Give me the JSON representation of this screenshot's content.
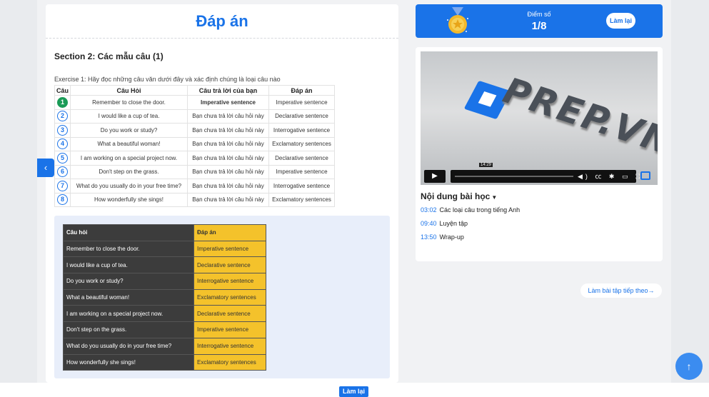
{
  "left_panel": {
    "title": "Đáp án",
    "section_title": "Section 2: Các mẫu câu (1)",
    "exercise_text": "Exercise 1: Hãy đọc những câu văn dưới đây và xác định chúng là loại câu nào",
    "table_headers": [
      "Câu",
      "Câu Hỏi",
      "Câu trả lời của bạn",
      "Đáp án"
    ],
    "rows": [
      {
        "num": "1",
        "question": "Remember to close the door.",
        "your_answer": "Imperative sentence",
        "answer": "Imperative sentence"
      },
      {
        "num": "2",
        "question": "I would like a cup of tea.",
        "your_answer": "Bạn chưa trả lời câu hỏi này",
        "answer": "Declarative sentence"
      },
      {
        "num": "3",
        "question": "Do you work or study?",
        "your_answer": "Bạn chưa trả lời câu hỏi này",
        "answer": "Interrogative sentence"
      },
      {
        "num": "4",
        "question": "What a beautiful woman!",
        "your_answer": "Bạn chưa trả lời câu hỏi này",
        "answer": "Exclamatory sentences"
      },
      {
        "num": "5",
        "question": "I am working on a special project now.",
        "your_answer": "Bạn chưa trả lời câu hỏi này",
        "answer": "Declarative sentence"
      },
      {
        "num": "6",
        "question": "Don't step on the grass.",
        "your_answer": "Bạn chưa trả lời câu hỏi này",
        "answer": "Imperative sentence"
      },
      {
        "num": "7",
        "question": "What do you usually do in your free time?",
        "your_answer": "Bạn chưa trả lời câu hỏi này",
        "answer": "Interrogative sentence"
      },
      {
        "num": "8",
        "question": "How wonderfully she sings!",
        "your_answer": "Bạn chưa trả lời câu hỏi này",
        "answer": "Exclamatory sentences"
      }
    ],
    "answer_table": {
      "headers": [
        "Câu hỏi",
        "Đáp án"
      ],
      "rows": [
        [
          "Remember to close the door.",
          "Imperative sentence"
        ],
        [
          "I would like a cup of tea.",
          "Declarative sentence"
        ],
        [
          "Do you work or study?",
          "Interrogative sentence"
        ],
        [
          "What a beautiful woman!",
          "Exclamatory sentences"
        ],
        [
          "I am working on a special project now.",
          "Declarative sentence"
        ],
        [
          "Don't step on the grass.",
          "Imperative sentence"
        ],
        [
          "What do you usually do in your free time?",
          "Interrogative sentence"
        ],
        [
          "How wonderfully she sings!",
          "Exclamatory sentences"
        ]
      ]
    },
    "side_tab_icon": "chevron-left-icon"
  },
  "score": {
    "label": "Điểm số",
    "value": "1/8",
    "retry_label": "Làm lại",
    "medal_icon": "medal-icon"
  },
  "video": {
    "logo_text": "PREP.VN",
    "time_tooltip": "14:29",
    "play_icon": "play-icon",
    "control_icons": "◀) ㏄ ✱ ▭ ⛶"
  },
  "content": {
    "title": "Nội dung bài học",
    "chapters": [
      {
        "time": "03:02",
        "label": "Các loại câu trong tiếng Anh"
      },
      {
        "time": "09:40",
        "label": "Luyện tập"
      },
      {
        "time": "13:50",
        "label": "Wrap-up"
      }
    ]
  },
  "next_button_label": "Làm bài tập tiếp theo",
  "bottom_retry_label": "Làm lại",
  "scroll_top_icon": "arrow-up-icon",
  "colors": {
    "accent": "#1a73e8",
    "answer_yellow": "#f4c22b",
    "error_red": "#e02020",
    "done_green": "#1a9b57"
  }
}
